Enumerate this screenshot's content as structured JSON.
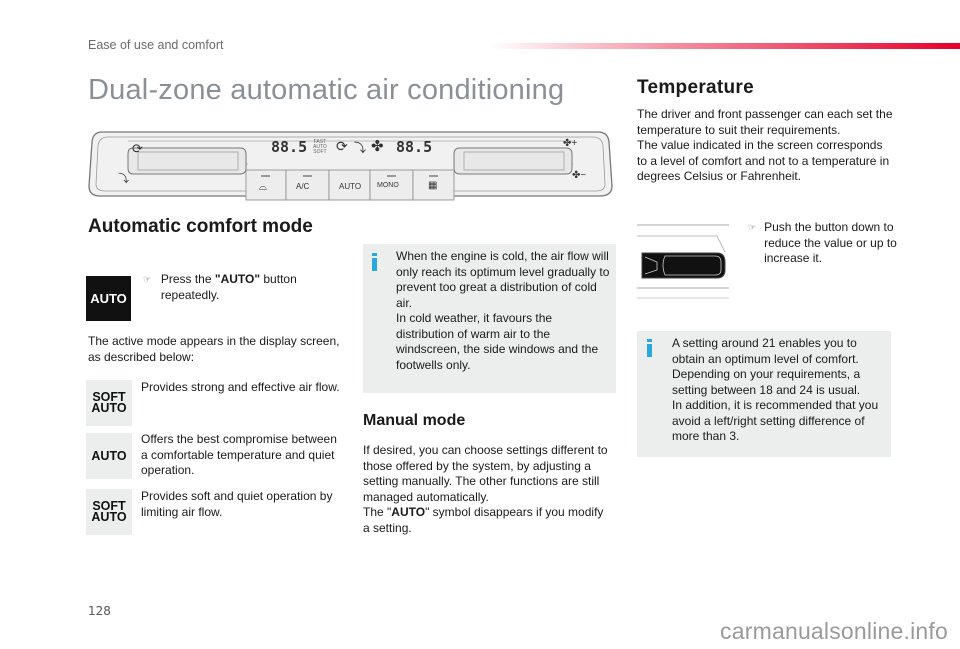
{
  "header": {
    "section": "Ease of use and comfort",
    "accent_color": "#e6002a"
  },
  "page_title": "Dual-zone automatic air conditioning",
  "control_panel": {
    "display_left": "88.5",
    "display_right": "88.5",
    "mode_stack": [
      "FAST",
      "AUTO",
      "SOFT"
    ],
    "buttons": [
      {
        "label": "",
        "icon": "windscreen-demist-icon"
      },
      {
        "label": "A/C",
        "icon": ""
      },
      {
        "label": "AUTO",
        "icon": ""
      },
      {
        "label": "MONO",
        "icon": ""
      },
      {
        "label": "",
        "icon": "rear-demist-icon"
      }
    ],
    "left_side_icons": [
      "recirculation-icon",
      "air-distribution-icon"
    ],
    "right_side_labels": [
      "+",
      "−"
    ]
  },
  "automatic": {
    "heading": "Automatic comfort mode",
    "auto_button_label": "AUTO",
    "instruction_prefix": "Press the ",
    "instruction_bold": "\"AUTO\"",
    "instruction_suffix": " button repeatedly.",
    "intro": "The active mode appears in the display screen, as described below:",
    "modes": [
      {
        "icon_line1": "SOFT",
        "icon_line2": "AUTO",
        "description": "Provides strong and effective air flow."
      },
      {
        "icon_line1": "",
        "icon_line2": "AUTO",
        "description": "Offers the best compromise between a comfortable temperature and quiet operation."
      },
      {
        "icon_line1": "SOFT",
        "icon_line2": "AUTO",
        "description": "Provides soft and quiet operation by limiting air flow."
      }
    ]
  },
  "info_cold_engine": {
    "lines": [
      "When the engine is cold, the air flow will only reach its optimum level gradually to prevent too great a distribution of cold air.",
      "In cold weather, it favours the distribution of warm air to the windscreen, the side windows and the footwells only."
    ],
    "icon_color": "#29a8e0"
  },
  "manual": {
    "heading": "Manual mode",
    "text1": "If desired, you can choose settings different to those offered by the system, by adjusting a setting manually. The other functions are still managed automatically.",
    "text2_prefix": "The \"",
    "text2_bold": "AUTO",
    "text2_suffix": "\" symbol disappears if you modify a setting."
  },
  "temperature": {
    "heading": "Temperature",
    "text1": "The driver and front passenger can each set the temperature to suit their requirements.",
    "text2": "The value indicated in the screen corresponds to a level of comfort and not to a temperature in degrees Celsius or Fahrenheit.",
    "instruction": "Push the button down to reduce the value or up to increase it."
  },
  "info_setting": {
    "lines": [
      "A setting around 21 enables you to obtain an optimum level of comfort.",
      "Depending on your requirements, a setting between 18 and 24 is usual.",
      "In addition, it is recommended that you avoid a left/right setting difference of more than 3."
    ]
  },
  "footer": {
    "page_number": "128",
    "watermark": "carmanualsonline.info"
  }
}
